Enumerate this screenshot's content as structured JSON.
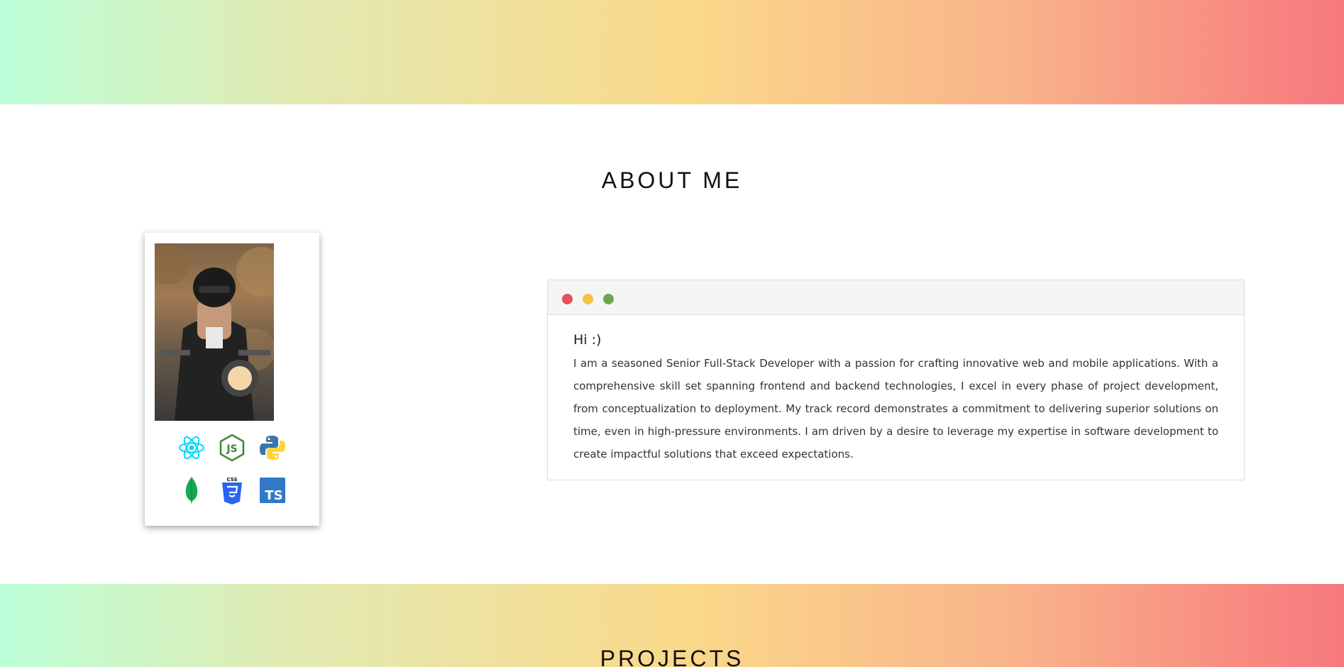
{
  "about": {
    "title": "ABOUT ME",
    "greeting": "Hi :)",
    "bio": "I am a seasoned Senior Full-Stack Developer with a passion for crafting innovative web and mobile applications. With a comprehensive skill set spanning frontend and backend technologies, I excel in every phase of project development, from conceptualization to deployment. My track record demonstrates a commitment to delivering superior solutions on time, even in high-pressure environments. I am driven by a desire to leverage my expertise in software development to create impactful solutions that exceed expectations."
  },
  "profile": {
    "photo": "profile-photo-motorcycle-rider",
    "tech_icons": [
      {
        "name": "react-icon",
        "color": "#00d8ff"
      },
      {
        "name": "nodejs-icon",
        "color": "#3c873a"
      },
      {
        "name": "python-icon",
        "color": "#3776ab"
      },
      {
        "name": "mongodb-icon",
        "color": "#13aa52"
      },
      {
        "name": "css3-icon",
        "color": "#2965f1"
      },
      {
        "name": "typescript-icon",
        "color": "#3178c6"
      }
    ],
    "css_badge": "CSS",
    "ts_badge": "TS"
  },
  "window_controls": {
    "close_color": "#e8505b",
    "minimize_color": "#f6c244",
    "maximize_color": "#6aa84f"
  },
  "projects": {
    "title": "PROJECTS"
  }
}
